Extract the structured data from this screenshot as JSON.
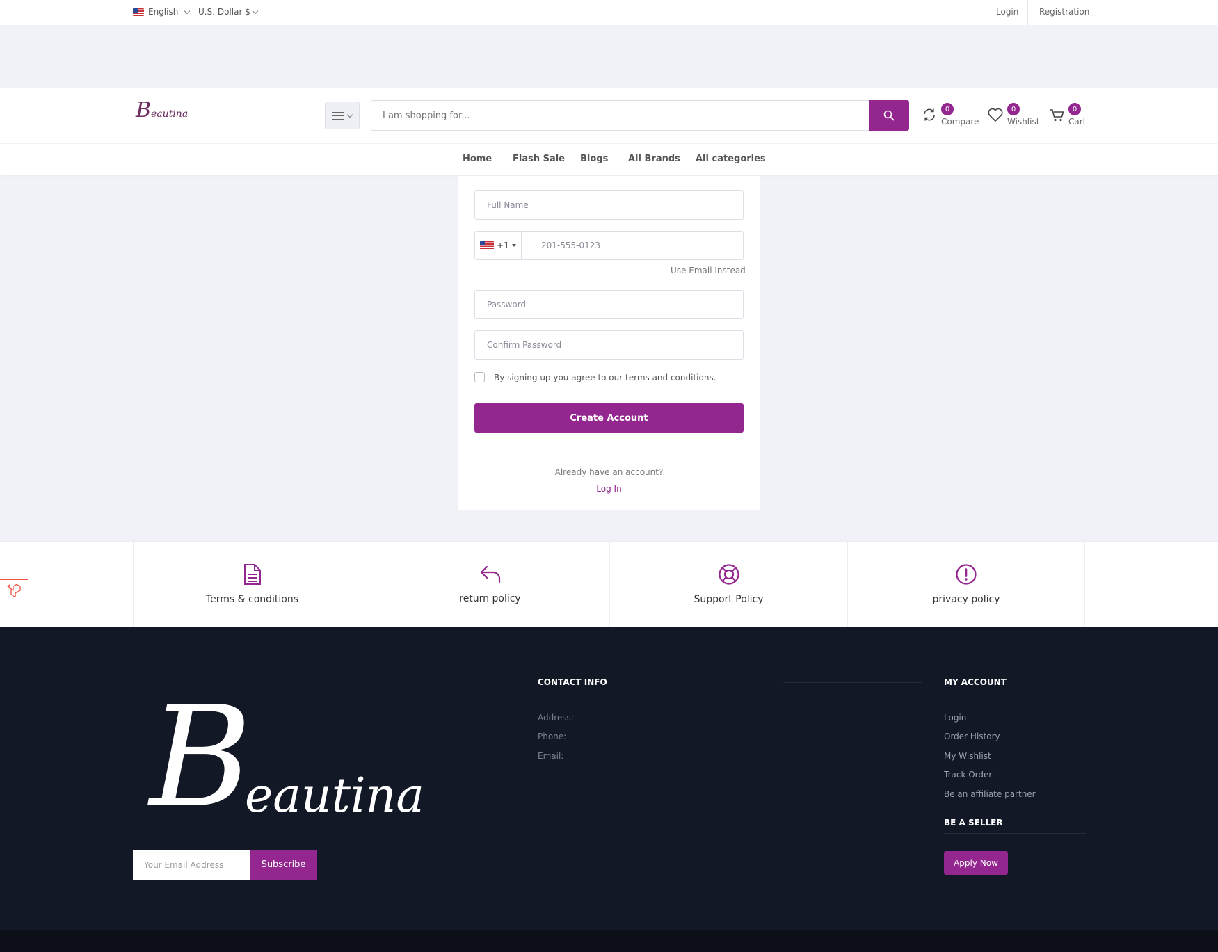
{
  "topbar": {
    "language": "English",
    "currency": "U.S. Dollar $",
    "login": "Login",
    "registration": "Registration"
  },
  "header": {
    "logo_initial": "B",
    "logo_rest": "eautina",
    "search_placeholder": "I am shopping for...",
    "compare": {
      "label": "Compare",
      "count": "0"
    },
    "wishlist": {
      "label": "Wishlist",
      "count": "0"
    },
    "cart": {
      "label": "Cart",
      "count": "0"
    }
  },
  "nav": {
    "items": [
      {
        "label": "Home"
      },
      {
        "label": "Flash Sale"
      },
      {
        "label": "Blogs"
      },
      {
        "label": "All Brands"
      },
      {
        "label": "All categories"
      }
    ]
  },
  "form": {
    "full_name_placeholder": "Full Name",
    "phone_code": "+1",
    "phone_placeholder": "201-555-0123",
    "use_email": "Use Email Instead",
    "password_placeholder": "Password",
    "confirm_placeholder": "Confirm Password",
    "terms_text": "By signing up you agree to our terms and conditions.",
    "create_button": "Create Account",
    "have_account": "Already have an account?",
    "login_link": "Log In"
  },
  "policies": [
    {
      "label": "Terms & conditions",
      "icon": "document-icon"
    },
    {
      "label": "return policy",
      "icon": "return-arrow-icon"
    },
    {
      "label": "Support Policy",
      "icon": "lifebuoy-icon"
    },
    {
      "label": "privacy policy",
      "icon": "exclamation-circle-icon"
    }
  ],
  "footer": {
    "logo_initial": "B",
    "logo_rest": "eautina",
    "email_placeholder": "Your Email Address",
    "subscribe": "Subscribe",
    "contact_title": "CONTACT INFO",
    "address_label": "Address:",
    "phone_label": "Phone:",
    "email_label": "Email:",
    "account_title": "MY ACCOUNT",
    "account_links": [
      "Login",
      "Order History",
      "My Wishlist",
      "Track Order",
      "Be an affiliate partner"
    ],
    "seller_title": "BE A SELLER",
    "apply_now": "Apply Now"
  },
  "colors": {
    "brand": "#93278f",
    "footer_bg": "#131826",
    "page_bg": "#f1f2f7"
  }
}
